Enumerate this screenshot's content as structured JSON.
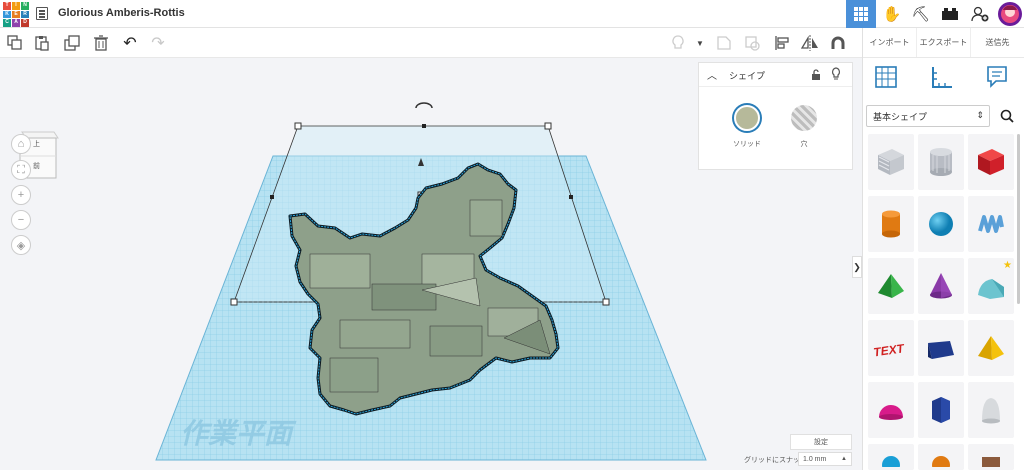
{
  "app": {
    "logo_letters": [
      "TIN",
      "KER",
      "CAD"
    ],
    "design_title": "Glorious Amberis-Rottis"
  },
  "toolbar": {
    "left_tools": [
      "copy-icon",
      "paste-icon",
      "duplicate-icon",
      "delete-icon",
      "undo-icon",
      "redo-icon"
    ],
    "right_tools": [
      "light-icon",
      "dropdown-icon",
      "group-icon",
      "ungroup-icon",
      "align-icon",
      "mirror-icon",
      "magnet-icon"
    ]
  },
  "header_right": {
    "icons": [
      "grid-view-icon",
      "hand-icon",
      "pickaxe-icon",
      "bricks-icon",
      "add-user-icon",
      "avatar"
    ]
  },
  "panel_tabs": [
    "インポート",
    "エクスポート",
    "送信先"
  ],
  "viewcube": {
    "top": "上",
    "front": "前"
  },
  "inspector": {
    "title": "シェイプ",
    "solid_label": "ソリッド",
    "hole_label": "穴",
    "solid_color": "#b6b99a"
  },
  "shapes_panel": {
    "category": "基本シェイプ",
    "shapes": [
      {
        "name": "box-striped",
        "color": "#b8bcc4"
      },
      {
        "name": "cylinder-striped",
        "color": "#b8bcc4"
      },
      {
        "name": "box",
        "color": "#d0202a"
      },
      {
        "name": "cylinder",
        "color": "#e07a12"
      },
      {
        "name": "sphere",
        "color": "#1a9fd6"
      },
      {
        "name": "scribble",
        "color": "#5aa0d8"
      },
      {
        "name": "pyramid",
        "color": "#2a9a3c"
      },
      {
        "name": "cone",
        "color": "#8a3aa8"
      },
      {
        "name": "roof",
        "color": "#6cc4cf"
      },
      {
        "name": "text",
        "color": "#d02020"
      },
      {
        "name": "wedge",
        "color": "#1f3a8c"
      },
      {
        "name": "pyramid-yellow",
        "color": "#f4c20d"
      },
      {
        "name": "half-sphere",
        "color": "#d81b8a"
      },
      {
        "name": "polygon",
        "color": "#1f3a8c"
      },
      {
        "name": "paraboloid",
        "color": "#c8ccd0"
      }
    ]
  },
  "workplane": {
    "label": "作業平面"
  },
  "bottom": {
    "settings_label": "設定",
    "snap_label": "グリッドにスナップ",
    "snap_value": "1.0 mm"
  },
  "colors": {
    "accent": "#2a7db8",
    "grid": "#9fd4ea"
  }
}
